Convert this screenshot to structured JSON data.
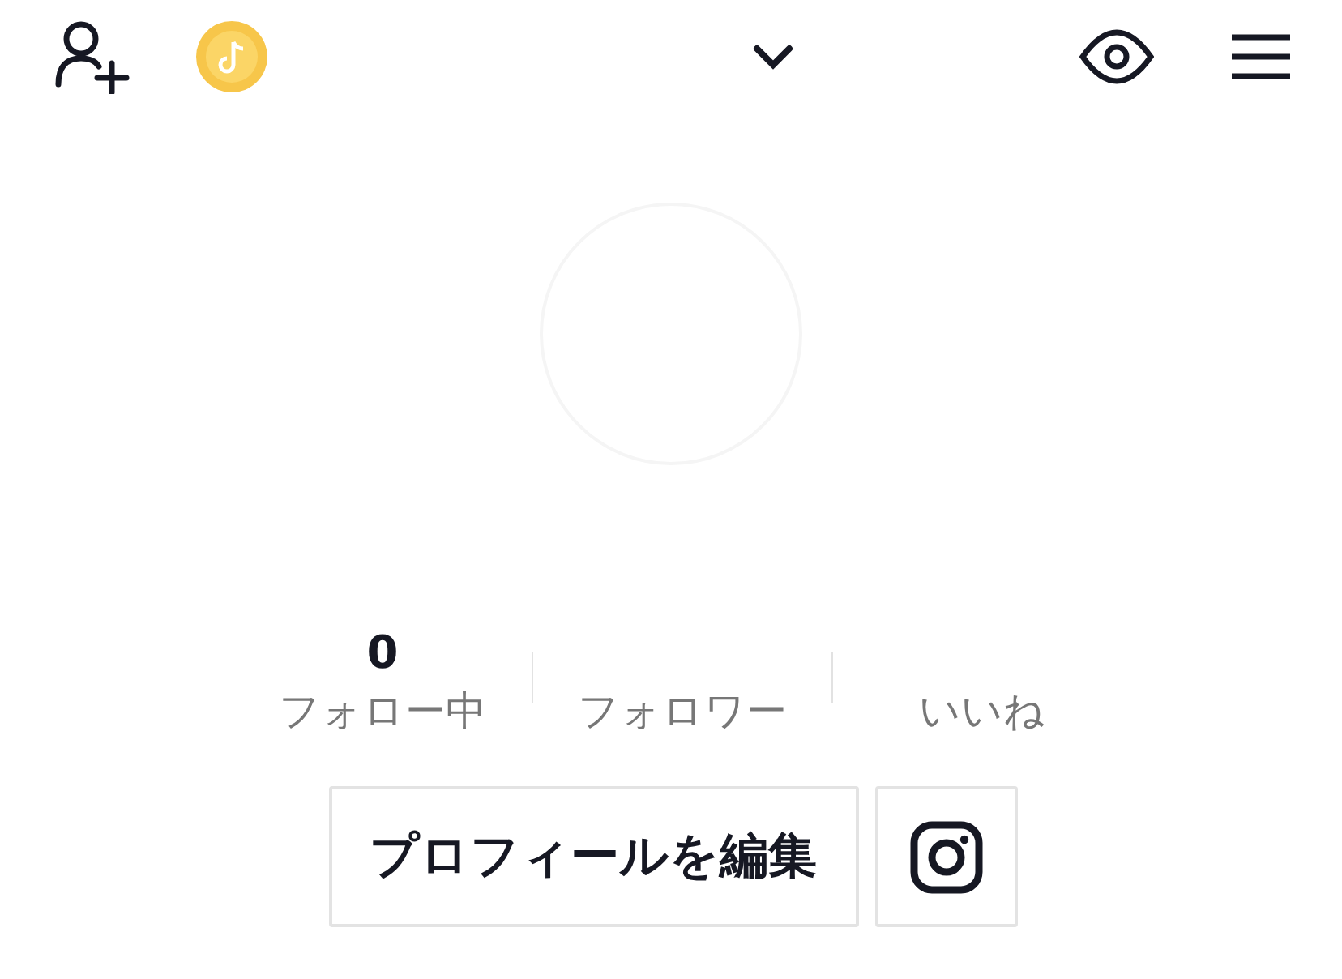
{
  "stats": [
    {
      "value": "0",
      "label": "フォロー中"
    },
    {
      "label": "フォロワー"
    },
    {
      "label": "いいね"
    }
  ],
  "edit_button": "プロフィールを編集"
}
